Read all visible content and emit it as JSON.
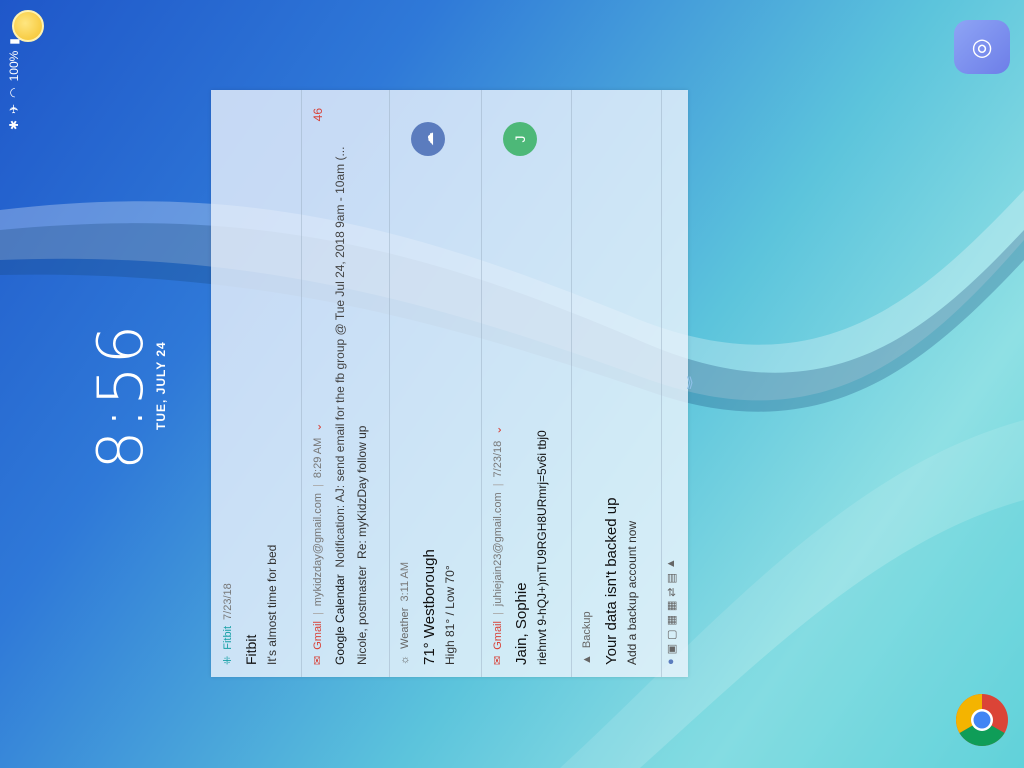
{
  "status_bar": {
    "battery": "100%"
  },
  "lock_clock": {
    "time": "8:56",
    "date": "TUE, JULY 24"
  },
  "notifications": [
    {
      "app": "Fitbit",
      "time": "7/23/18",
      "title": "Fitbit",
      "text": "It's almost time for bed"
    },
    {
      "app": "Gmail",
      "account": "mykidzday@gmail.com",
      "time": "8:29 AM",
      "count": "46",
      "line1_sender": "Google Calendar",
      "line1_text": "Notification: AJ: send email for the fb group @ Tue Jul 24, 2018 9am - 10am (...",
      "line2_sender": "Nicole, postmaster",
      "line2_text": "Re: myKidzDay follow up"
    },
    {
      "app": "Weather",
      "time": "3:11 AM",
      "title": "71° Westborough",
      "text": "High 81° / Low 70°"
    },
    {
      "app": "Gmail",
      "account": "juhiejain23@gmail.com",
      "time": "7/23/18",
      "title": "Jain, Sophie",
      "text": "riehnvt 9-hQJ+)mTU9RGH8URmrj=5v6i tbj0",
      "avatar": "J"
    },
    {
      "app": "Backup",
      "title": "Your data isn't backed up",
      "text": "Add a backup account now"
    }
  ],
  "icons": {
    "camera": "camera-icon",
    "chrome": "chrome-icon"
  }
}
